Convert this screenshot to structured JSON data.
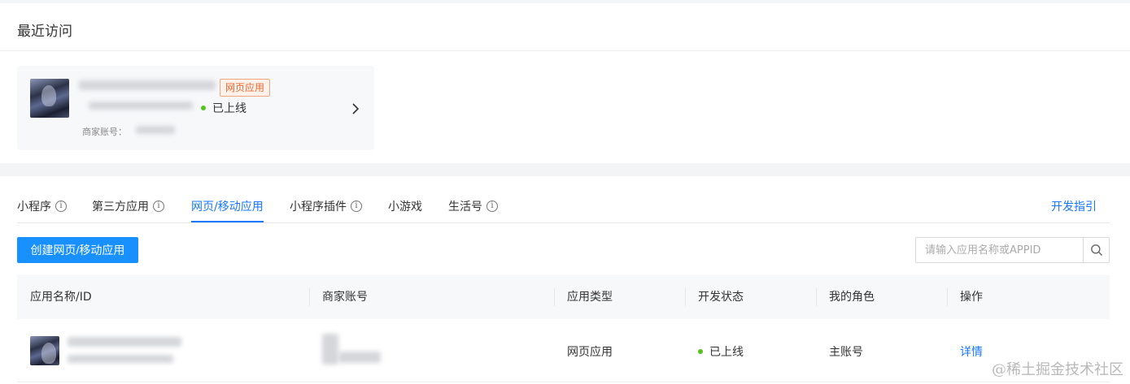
{
  "recent": {
    "title": "最近访问",
    "card": {
      "tag": "网页应用",
      "status": "已上线",
      "merchant_label": "商家账号："
    }
  },
  "tabs": [
    {
      "label": "小程序",
      "info": true
    },
    {
      "label": "第三方应用",
      "info": true
    },
    {
      "label": "网页/移动应用",
      "info": false,
      "active": true
    },
    {
      "label": "小程序插件",
      "info": true
    },
    {
      "label": "小游戏",
      "info": false
    },
    {
      "label": "生活号",
      "info": true
    }
  ],
  "guide_link": "开发指引",
  "create_button": "创建网页/移动应用",
  "search": {
    "placeholder": "请输入应用名称或APPID"
  },
  "table": {
    "headers": [
      "应用名称/ID",
      "商家账号",
      "应用类型",
      "开发状态",
      "我的角色",
      "操作"
    ],
    "rows": [
      {
        "type": "网页应用",
        "status": "已上线",
        "role": "主账号",
        "action": "详情"
      }
    ]
  },
  "colors": {
    "accent": "#1677ff",
    "status_online": "#52c41a",
    "tag_text": "#e66a31"
  },
  "watermark": "@稀土掘金技术社区"
}
